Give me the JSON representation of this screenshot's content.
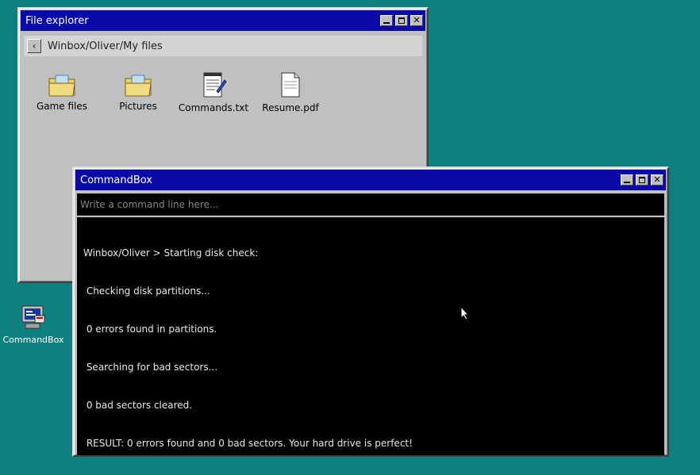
{
  "file_explorer": {
    "title": "File explorer",
    "path": "Winbox/Oliver/My files",
    "items": [
      {
        "label": "Game files",
        "icon": "folder-icon"
      },
      {
        "label": "Pictures",
        "icon": "folder-icon"
      },
      {
        "label": "Commands.txt",
        "icon": "text-document-icon"
      },
      {
        "label": "Resume.pdf",
        "icon": "document-icon"
      }
    ]
  },
  "desktop": {
    "icons": [
      {
        "label": "CommandBox",
        "icon": "computer-terminal-icon"
      }
    ]
  },
  "commandbox": {
    "title": "CommandBox",
    "input_placeholder": "Write a command line here...",
    "output_lines": [
      "Winbox/Oliver > Starting disk check:",
      " Checking disk partitions...",
      " 0 errors found in partitions.",
      " Searching for bad sectors...",
      " 0 bad sectors cleared.",
      " RESULT: 0 errors found and 0 bad sectors. Your hard drive is perfect!"
    ]
  },
  "colors": {
    "desktop": "#0f7f7f",
    "titlebar": "#0a0aa8",
    "window": "#c0c0c0",
    "console": "#000000"
  }
}
